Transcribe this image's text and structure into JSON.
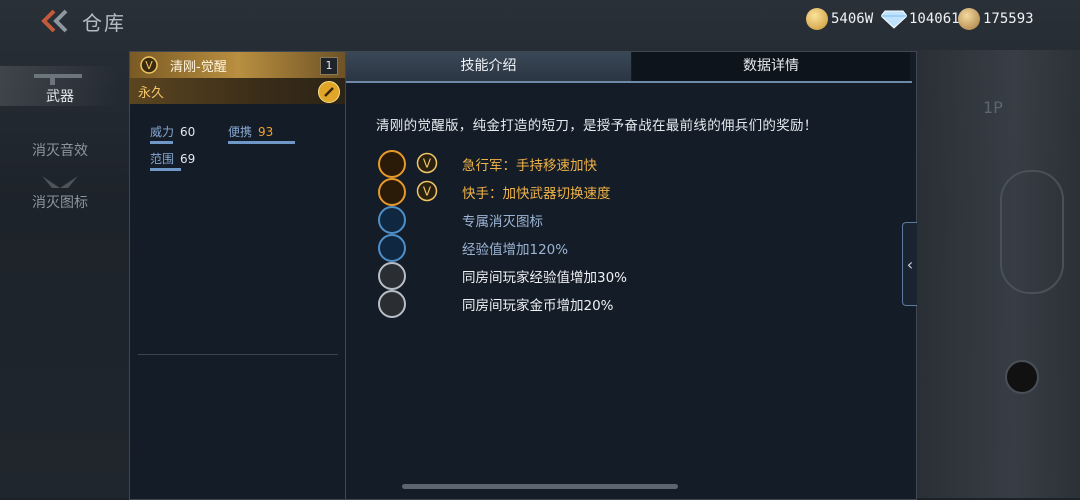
{
  "topbar": {
    "title": "仓库"
  },
  "currencies": [
    {
      "icon": "gold-plus-coin-icon",
      "value": "5406W"
    },
    {
      "icon": "diamond-icon",
      "value": "104061"
    },
    {
      "icon": "honor-coin-icon",
      "value": "175593"
    }
  ],
  "nav": [
    {
      "label": "武器",
      "active": true
    },
    {
      "label": "消灭音效",
      "active": false
    },
    {
      "label": "消灭图标",
      "active": false
    }
  ],
  "item": {
    "name": "清刚-觉醒",
    "count": "1",
    "duration": "永久",
    "stats": [
      {
        "label": "威力",
        "value": "60",
        "fraction": 0.5
      },
      {
        "label": "便携",
        "value": "93",
        "fraction": 0.93
      },
      {
        "label": "范围",
        "value": "69",
        "fraction": 0.55
      }
    ]
  },
  "tabs": [
    "技能介绍",
    "数据详情"
  ],
  "description": "清刚的觉醒版，纯金打造的短刀，是授予奋战在最前线的佣兵们的奖励！",
  "perks": [
    {
      "icon": "sprint-icon",
      "vip": true,
      "text": "急行军：手持移速加快",
      "color": "gold"
    },
    {
      "icon": "quick-swap-icon",
      "vip": true,
      "text": "快手：加快武器切换速度",
      "color": "gold"
    },
    {
      "icon": "kill-icon-badge",
      "vip": false,
      "text": "专属消灭图标",
      "color": "blue"
    },
    {
      "icon": "exp-icon",
      "vip": false,
      "text": "经验值增加120%",
      "color": "blue"
    },
    {
      "icon": "room-exp-icon",
      "vip": false,
      "text": "同房间玩家经验值增加30%",
      "color": "white"
    },
    {
      "icon": "room-coin-icon",
      "vip": false,
      "text": "同房间玩家金币增加20%",
      "color": "white"
    }
  ],
  "side": {
    "player_label": "1P"
  }
}
